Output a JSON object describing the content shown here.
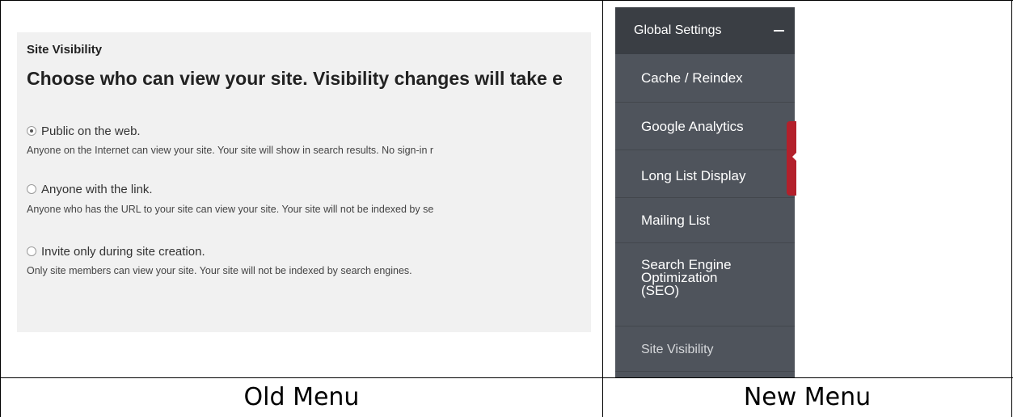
{
  "old_menu": {
    "section_title": "Site Visibility",
    "heading": "Choose who can view your site. Visibility changes will take e",
    "options": [
      {
        "label": "Public on the web.",
        "checked": true,
        "description": "Anyone on the Internet can view your site. Your site will show in search results. No sign-in r"
      },
      {
        "label": "Anyone with the link.",
        "checked": false,
        "description": "Anyone who has the URL to your site can view your site. Your site will not be indexed by se"
      },
      {
        "label": "Invite only during site creation.",
        "checked": false,
        "description": "Only site members can view your site. Your site will not be indexed by search engines."
      }
    ]
  },
  "new_menu": {
    "header": "Global Settings",
    "header_icon": "minus-icon",
    "items": [
      {
        "label": "Cache / Reindex"
      },
      {
        "label": "Google Analytics"
      },
      {
        "label": "Long List Display"
      },
      {
        "label": "Mailing List"
      },
      {
        "label": "Search Engine\nOptimization\n(SEO)"
      },
      {
        "label": "Site Visibility"
      }
    ],
    "colors": {
      "sidebar": "#4f545c",
      "header": "#3a3e44",
      "handle": "#b3202b"
    }
  },
  "captions": {
    "old": "Old Menu",
    "new": "New Menu"
  }
}
